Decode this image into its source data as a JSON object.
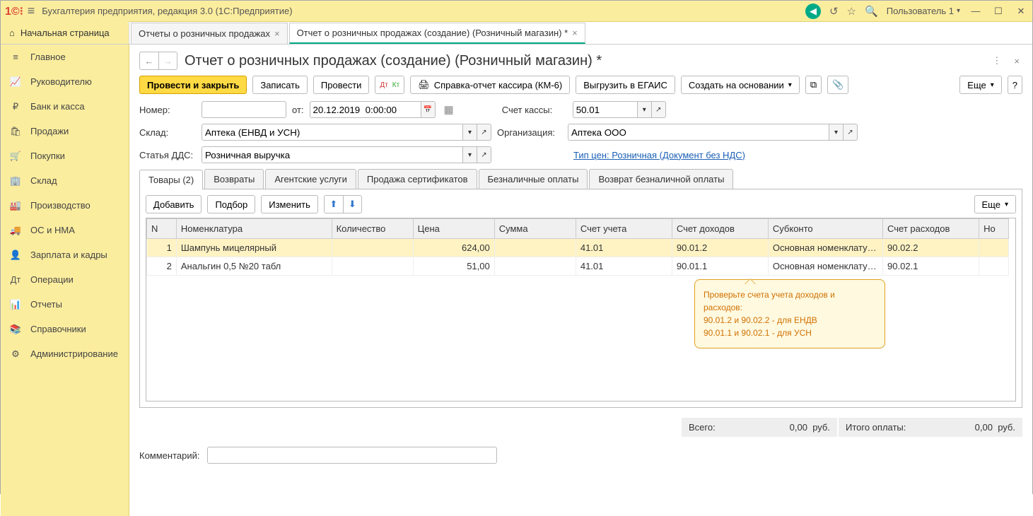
{
  "app": {
    "title": "Бухгалтерия предприятия, редакция 3.0  (1С:Предприятие)",
    "user": "Пользователь 1"
  },
  "tabs": {
    "home": "Начальная страница",
    "t1": "Отчеты о розничных продажах",
    "t2": "Отчет о розничных продажах (создание) (Розничный магазин) *"
  },
  "sidebar": [
    {
      "icon": "≡",
      "label": "Главное"
    },
    {
      "icon": "📈",
      "label": "Руководителю"
    },
    {
      "icon": "₽",
      "label": "Банк и касса"
    },
    {
      "icon": "🛍",
      "label": "Продажи"
    },
    {
      "icon": "🛒",
      "label": "Покупки"
    },
    {
      "icon": "🏢",
      "label": "Склад"
    },
    {
      "icon": "🏭",
      "label": "Производство"
    },
    {
      "icon": "🚚",
      "label": "ОС и НМА"
    },
    {
      "icon": "👤",
      "label": "Зарплата и кадры"
    },
    {
      "icon": "Дт",
      "label": "Операции"
    },
    {
      "icon": "📊",
      "label": "Отчеты"
    },
    {
      "icon": "📚",
      "label": "Справочники"
    },
    {
      "icon": "⚙",
      "label": "Администрирование"
    }
  ],
  "doc": {
    "title": "Отчет о розничных продажах (создание) (Розничный магазин) *",
    "buttons": {
      "post_close": "Провести и закрыть",
      "save": "Записать",
      "post": "Провести",
      "km6": "Справка-отчет кассира (КМ-6)",
      "egais": "Выгрузить в ЕГАИС",
      "create_based": "Создать на основании",
      "more": "Еще"
    },
    "fields": {
      "number_l": "Номер:",
      "number": "",
      "from": "от:",
      "date": "20.12.2019  0:00:00",
      "account_l": "Счет кассы:",
      "account": "50.01",
      "warehouse_l": "Склад:",
      "warehouse": "Аптека (ЕНВД и УСН)",
      "org_l": "Организация:",
      "org": "Аптека ООО",
      "dds_l": "Статья ДДС:",
      "dds": "Розничная выручка",
      "price_type": "Тип цен: Розничная (Документ без НДС)"
    }
  },
  "inner_tabs": {
    "t1": "Товары (2)",
    "t2": "Возвраты",
    "t3": "Агентские услуги",
    "t4": "Продажа сертификатов",
    "t5": "Безналичные оплаты",
    "t6": "Возврат безналичной оплаты"
  },
  "table": {
    "btns": {
      "add": "Добавить",
      "pick": "Подбор",
      "edit": "Изменить",
      "more": "Еще"
    },
    "headers": {
      "n": "N",
      "nom": "Номенклатура",
      "qty": "Количество",
      "price": "Цена",
      "sum": "Сумма",
      "acc": "Счет учета",
      "inc": "Счет доходов",
      "sub": "Субконто",
      "exp": "Счет расходов",
      "num": "Но"
    },
    "rows": [
      {
        "n": "1",
        "nom": "Шампунь мицелярный",
        "qty": "",
        "price": "624,00",
        "sum": "",
        "acc": "41.01",
        "inc": "90.01.2",
        "sub": "Основная номенклату…",
        "exp": "90.02.2"
      },
      {
        "n": "2",
        "nom": "Анальгин 0,5 №20 табл",
        "qty": "",
        "price": "51,00",
        "sum": "",
        "acc": "41.01",
        "inc": "90.01.1",
        "sub": "Основная номенклату…",
        "exp": "90.02.1"
      }
    ]
  },
  "callout": {
    "l1": "Проверьте счета учета доходов и расходов:",
    "l2": "90.01.2 и 90.02.2 - для ЕНДВ",
    "l3": "90.01.1 и 90.02.1 - для УСН"
  },
  "totals": {
    "total_l": "Всего:",
    "total_v": "0,00",
    "rub": "руб.",
    "paid_l": "Итого оплаты:",
    "paid_v": "0,00"
  },
  "comment_l": "Комментарий:",
  "comment": ""
}
